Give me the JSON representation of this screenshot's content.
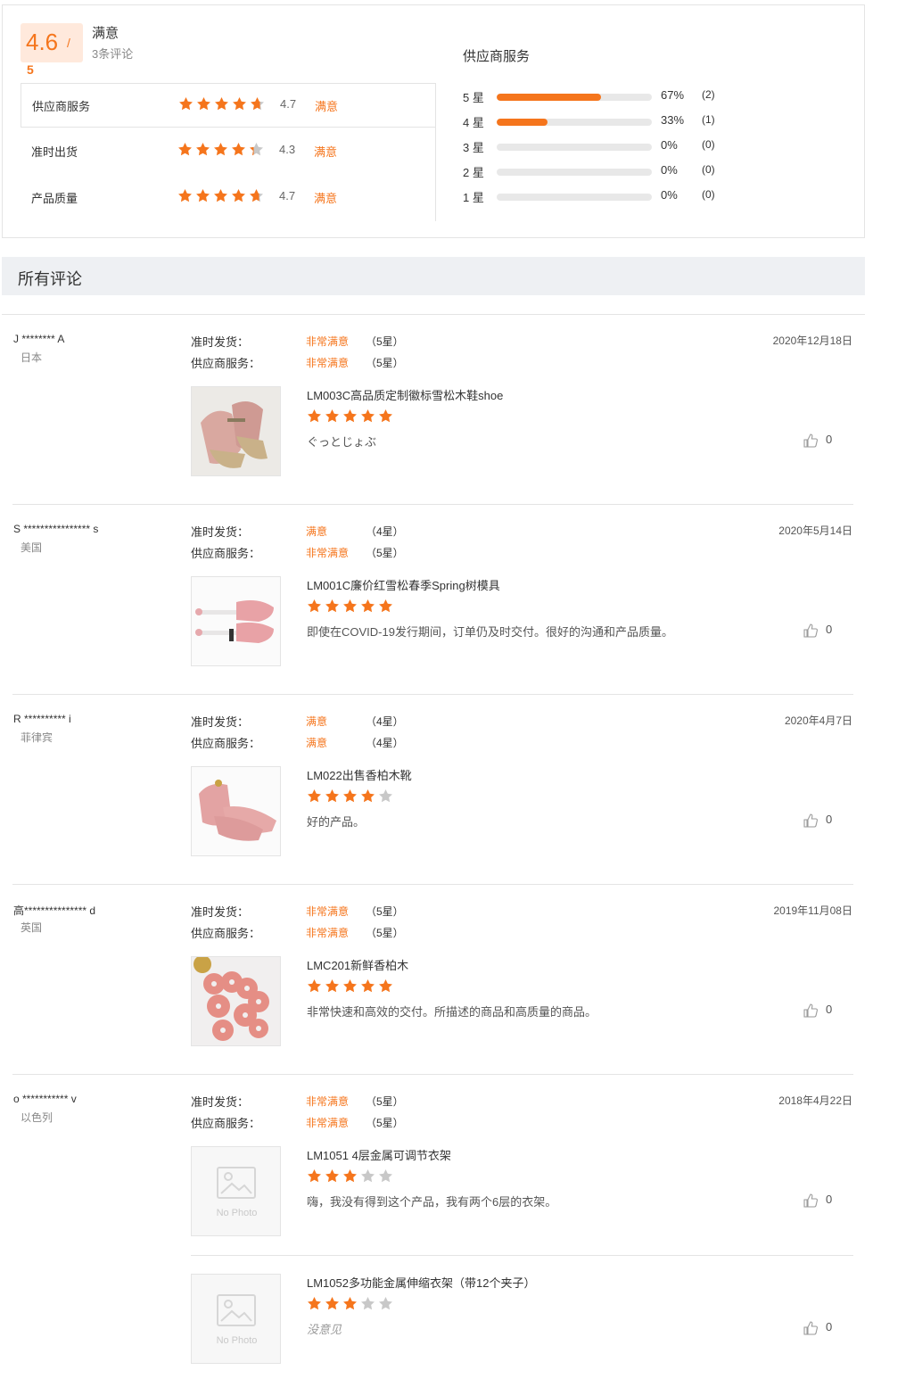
{
  "summary": {
    "score": "4.6",
    "slash": "/",
    "max": "5",
    "label": "满意",
    "count": "3条评论",
    "metrics": [
      {
        "name": "供应商服务",
        "stars": 4.7,
        "score": "4.7",
        "level": "满意"
      },
      {
        "name": "准时出货",
        "stars": 4.3,
        "score": "4.3",
        "level": "满意"
      },
      {
        "name": "产品质量",
        "stars": 4.7,
        "score": "4.7",
        "level": "满意"
      }
    ],
    "distribution_title": "供应商服务",
    "distribution": [
      {
        "label": "5 星",
        "fraction": 0.67,
        "pct": "67%",
        "count": "(2)"
      },
      {
        "label": "4 星",
        "fraction": 0.33,
        "pct": "33%",
        "count": "(1)"
      },
      {
        "label": "3 星",
        "fraction": 0,
        "pct": "0%",
        "count": "(0)"
      },
      {
        "label": "2 星",
        "fraction": 0,
        "pct": "0%",
        "count": "(0)"
      },
      {
        "label": "1 星",
        "fraction": 0,
        "pct": "0%",
        "count": "(0)"
      }
    ]
  },
  "section": {
    "title": "所有评论"
  },
  "labels": {
    "ontime": "准时发货：",
    "service": "供应商服务："
  },
  "colors": {
    "accent": "#f5751c",
    "star_empty": "#c8c8c8"
  },
  "reviews": [
    {
      "name": "J ******** A",
      "country": "日本",
      "date": "2020年12月18日",
      "ontime_level": "非常满意",
      "ontime_stars": "（5星）",
      "service_level": "非常满意",
      "service_stars": "（5星）",
      "products": [
        {
          "title": "LM003C高品质定制徽标雪松木鞋shoe",
          "rating": 5,
          "comment": "ぐっとじょぶ",
          "likes": "0",
          "image": "shoe-tree-pair"
        }
      ]
    },
    {
      "name": "S **************** s",
      "country": "美国",
      "date": "2020年5月14日",
      "ontime_level": "满意",
      "ontime_stars": "（4星）",
      "service_level": "非常满意",
      "service_stars": "（5星）",
      "products": [
        {
          "title": "LM001C廉价红雪松春季Spring树模具",
          "rating": 5,
          "comment": "即使在COVID-19发行期间，订单仍及时交付。很好的沟通和产品质量。",
          "likes": "0",
          "image": "spring-shoe-tree"
        }
      ]
    },
    {
      "name": "R ********** i",
      "country": "菲律宾",
      "date": "2020年4月7日",
      "ontime_level": "满意",
      "ontime_stars": "（4星）",
      "service_level": "满意",
      "service_stars": "（4星）",
      "products": [
        {
          "title": "LM022出售香柏木靴",
          "rating": 4,
          "comment": "好的产品。",
          "likes": "0",
          "image": "cedar-boot-tree"
        }
      ]
    },
    {
      "name": "高*************** d",
      "country": "英国",
      "date": "2019年11月08日",
      "ontime_level": "非常满意",
      "ontime_stars": "（5星）",
      "service_level": "非常满意",
      "service_stars": "（5星）",
      "products": [
        {
          "title": "LMC201新鲜香柏木",
          "rating": 5,
          "comment": "非常快速和高效的交付。所描述的商品和高质量的商品。",
          "likes": "0",
          "image": "cedar-rings"
        }
      ]
    },
    {
      "name": "o *********** v",
      "country": "以色列",
      "date": "2018年4月22日",
      "ontime_level": "非常满意",
      "ontime_stars": "（5星）",
      "service_level": "非常满意",
      "service_stars": "（5星）",
      "products": [
        {
          "title": "LM1051 4层金属可调节衣架",
          "rating": 3,
          "comment": "嗨，我没有得到这个产品，我有两个6层的衣架。",
          "likes": "0",
          "image": "no-photo",
          "nophoto_text": "No Photo"
        },
        {
          "title": "LM1052多功能金属伸缩衣架（带12个夹子）",
          "rating": 3,
          "comment": "没意见",
          "comment_empty": true,
          "likes": "0",
          "image": "no-photo",
          "nophoto_text": "No Photo"
        }
      ]
    }
  ]
}
